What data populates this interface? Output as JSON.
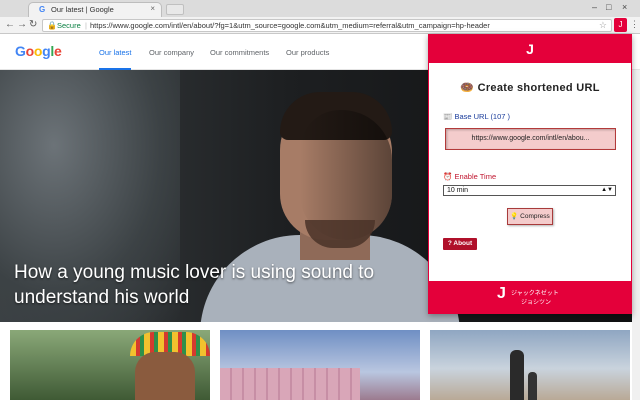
{
  "browser": {
    "tab_title": "Our latest | Google",
    "tab_favicon": "G",
    "tab_close": "×",
    "secure_label": "Secure",
    "url": "https://www.google.com/intl/en/about/?fg=1&utm_source=google.com&utm_medium=referral&utm_campaign=hp-header",
    "extension_icon_glyph": "J",
    "window_controls": [
      "–",
      "□",
      "×"
    ]
  },
  "site": {
    "logo": [
      "G",
      "o",
      "o",
      "g",
      "l",
      "e"
    ],
    "nav": [
      "Our latest",
      "Our company",
      "Our commitments",
      "Our products"
    ],
    "hero_title": "How a young music lover is using sound to understand his world"
  },
  "popup": {
    "header_logo": "J",
    "title": "Create shortened URL",
    "title_icon": "🍩",
    "base_url_label": "Base URL",
    "base_url_icon": "📰",
    "base_url_count": "(107 )",
    "base_url_value": "https://www.google.com/intl/en/abou...",
    "enable_time_label": "Enable Time",
    "enable_time_icon": "⏰",
    "enable_time_value": "10 min",
    "compress_label": "Compress",
    "compress_icon": "💡",
    "about_label": "? About",
    "footer_logo": "J",
    "footer_line1": "ジャックネゼット",
    "footer_line2": "ジョシツン",
    "accent_color": "#e4003a"
  }
}
